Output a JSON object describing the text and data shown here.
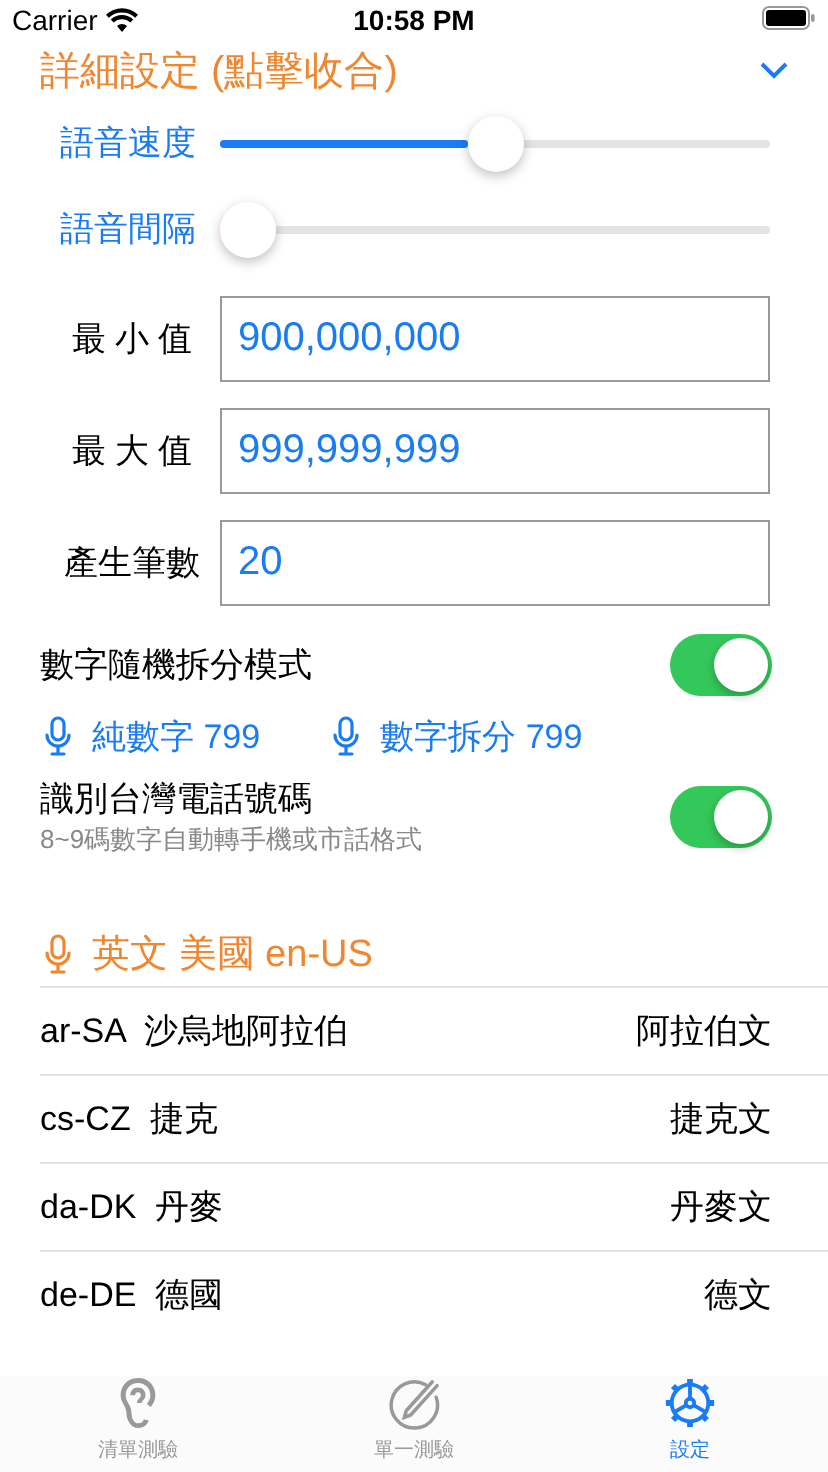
{
  "status_bar": {
    "carrier": "Carrier",
    "time": "10:58 PM"
  },
  "header": {
    "title": "詳細設定 (點擊收合)",
    "expanded": true
  },
  "sliders": [
    {
      "label": "語音速度",
      "level": 0.5
    },
    {
      "label": "語音間隔",
      "level": 0
    }
  ],
  "fields": [
    {
      "label": "最 小 值",
      "value": "900,000,000"
    },
    {
      "label": "最 大 值",
      "value": "999,999,999"
    },
    {
      "label": "產生筆數",
      "value": "20"
    }
  ],
  "random_split": {
    "label": "數字隨機拆分模式",
    "on": true
  },
  "voice_links": [
    {
      "label": "純數字 799"
    },
    {
      "label": "數字拆分 799"
    }
  ],
  "phone_mode": {
    "label": "識別台灣電話號碼",
    "subtitle": "8~9碼數字自動轉手機或市話格式",
    "on": true
  },
  "language": {
    "title": "英文 美國 en-US"
  },
  "languages": [
    {
      "code": "ar-SA",
      "region": "沙烏地阿拉伯",
      "name": "阿拉伯文"
    },
    {
      "code": "cs-CZ",
      "region": "捷克",
      "name": "捷克文"
    },
    {
      "code": "da-DK",
      "region": "丹麥",
      "name": "丹麥文"
    },
    {
      "code": "de-DE",
      "region": "德國",
      "name": "德文"
    }
  ],
  "tabs": [
    {
      "label": "清單測驗",
      "selected": false
    },
    {
      "label": "單一測驗",
      "selected": false
    },
    {
      "label": "設定",
      "selected": true
    }
  ]
}
